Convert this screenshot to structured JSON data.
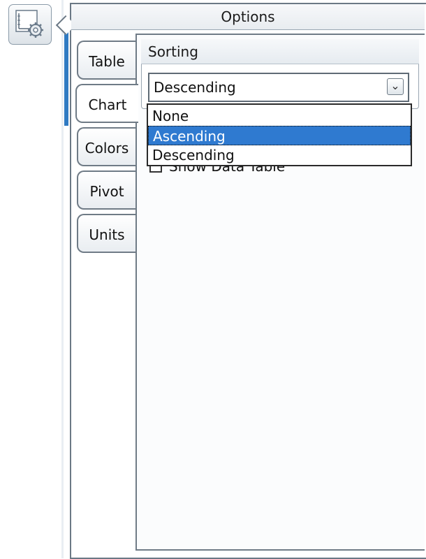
{
  "launcher": {
    "icon": "chart-settings-icon"
  },
  "panel": {
    "title": "Options"
  },
  "tabs": [
    {
      "label": "Table"
    },
    {
      "label": "Chart"
    },
    {
      "label": "Colors"
    },
    {
      "label": "Pivot"
    },
    {
      "label": "Units"
    }
  ],
  "active_tab": "Chart",
  "sorting": {
    "group_title": "Sorting",
    "selected_value": "Descending",
    "options": [
      {
        "label": "None"
      },
      {
        "label": "Ascending"
      },
      {
        "label": "Descending"
      }
    ],
    "highlighted_option": "Ascending"
  },
  "partially_hidden_checkbox": {
    "label": "Show Data Table"
  },
  "colors": {
    "accent": "#2f7ac2",
    "highlight": "#2f7ad0",
    "border": "#6b7885"
  }
}
